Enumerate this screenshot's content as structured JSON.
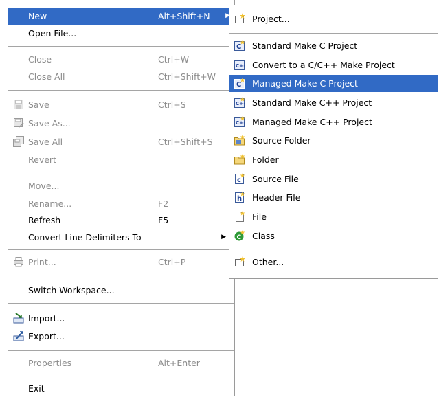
{
  "file_menu": {
    "new": {
      "label": "New",
      "accel": "Alt+Shift+N"
    },
    "open_file": {
      "label": "Open File..."
    },
    "close": {
      "label": "Close",
      "accel": "Ctrl+W"
    },
    "close_all": {
      "label": "Close All",
      "accel": "Ctrl+Shift+W"
    },
    "save": {
      "label": "Save",
      "accel": "Ctrl+S"
    },
    "save_as": {
      "label": "Save As..."
    },
    "save_all": {
      "label": "Save All",
      "accel": "Ctrl+Shift+S"
    },
    "revert": {
      "label": "Revert"
    },
    "move": {
      "label": "Move..."
    },
    "rename": {
      "label": "Rename...",
      "accel": "F2"
    },
    "refresh": {
      "label": "Refresh",
      "accel": "F5"
    },
    "convert_line_delimiters": {
      "label": "Convert Line Delimiters To"
    },
    "print": {
      "label": "Print...",
      "accel": "Ctrl+P"
    },
    "switch_workspace": {
      "label": "Switch Workspace..."
    },
    "import": {
      "label": "Import..."
    },
    "export": {
      "label": "Export..."
    },
    "properties": {
      "label": "Properties",
      "accel": "Alt+Enter"
    },
    "exit": {
      "label": "Exit"
    }
  },
  "new_submenu": {
    "items": [
      {
        "label": "Project...",
        "icon": "new-project-icon"
      },
      {
        "label": "Standard Make C Project",
        "icon": "c-project-icon"
      },
      {
        "label": "Convert to a C/C++ Make Project",
        "icon": "convert-cpp-icon"
      },
      {
        "label": "Managed Make C Project",
        "icon": "c-project-icon"
      },
      {
        "label": "Standard Make C++ Project",
        "icon": "cpp-project-icon"
      },
      {
        "label": "Managed Make C++ Project",
        "icon": "cpp-project-icon"
      },
      {
        "label": "Source Folder",
        "icon": "source-folder-icon"
      },
      {
        "label": "Folder",
        "icon": "folder-icon"
      },
      {
        "label": "Source File",
        "icon": "source-file-icon"
      },
      {
        "label": "Header File",
        "icon": "header-file-icon"
      },
      {
        "label": "File",
        "icon": "file-icon"
      },
      {
        "label": "Class",
        "icon": "class-icon"
      },
      {
        "label": "Other...",
        "icon": "new-wizard-icon"
      }
    ]
  },
  "colors": {
    "selection": "#316ac5",
    "disabled_text": "#8c8c8c",
    "separator": "#a5a5a5"
  }
}
